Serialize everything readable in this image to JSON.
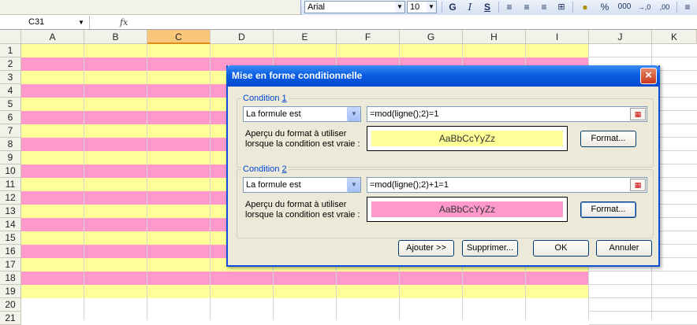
{
  "toolbar": {
    "font_name": "Arial",
    "font_size": "10",
    "bold_label": "G",
    "italic_label": "I",
    "underline_label": "S",
    "percent_label": "%",
    "thousands_label": "000",
    "inc_decimal_label": "→,0",
    "dec_decimal_label": ",00",
    "icons": [
      "bold-icon",
      "italic-icon",
      "underline-icon",
      "align-left-icon",
      "align-center-icon",
      "align-right-icon",
      "merge-center-icon",
      "currency-icon",
      "percent-icon",
      "thousands-icon",
      "increase-decimal-icon",
      "decrease-decimal-icon",
      "indent-icon"
    ]
  },
  "formula_bar": {
    "name_box": "C31",
    "fx_label": "fx",
    "formula": ""
  },
  "sheet": {
    "columns": [
      "A",
      "B",
      "C",
      "D",
      "E",
      "F",
      "G",
      "H",
      "I",
      "J",
      "K"
    ],
    "selected_column": "C",
    "rows": [
      "1",
      "2",
      "3",
      "4",
      "5",
      "6",
      "7",
      "8",
      "9",
      "10",
      "11",
      "12",
      "13",
      "14",
      "15",
      "16",
      "17",
      "18",
      "19",
      "20",
      "21"
    ],
    "band_colors": {
      "odd": "#ffff99",
      "even": "#ff99cc"
    }
  },
  "dialog": {
    "title": "Mise en forme conditionnelle",
    "close_label": "×",
    "condition1": {
      "legend_prefix": "Condition ",
      "legend_number": "1",
      "type": "La formule est",
      "formula": "=mod(ligne();2)=1",
      "preview_label_line1": "Aperçu du format à utiliser",
      "preview_label_line2": "lorsque la condition est vraie :",
      "preview_text": "AaBbCcYyZz",
      "preview_color": "#ffff99",
      "format_button": "Format..."
    },
    "condition2": {
      "legend_prefix": "Condition ",
      "legend_number": "2",
      "type": "La formule est",
      "formula": "=mod(ligne();2)+1=1",
      "preview_label_line1": "Aperçu du format à utiliser",
      "preview_label_line2": "lorsque la condition est vraie :",
      "preview_text": "AaBbCcYyZz",
      "preview_color": "#ff99cc",
      "format_button": "Format..."
    },
    "buttons": {
      "add": "Ajouter >>",
      "delete": "Supprimer...",
      "ok": "OK",
      "cancel": "Annuler"
    }
  }
}
